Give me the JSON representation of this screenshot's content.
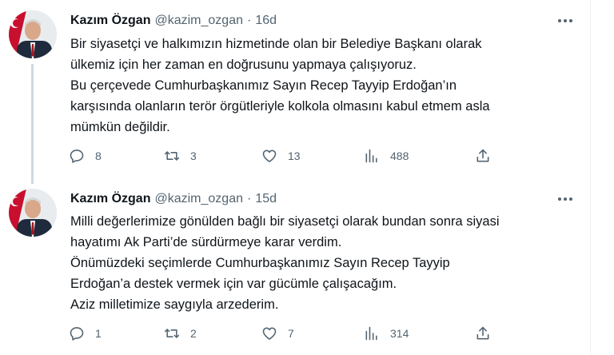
{
  "tweets": [
    {
      "display_name": "Kazım Özgan",
      "handle": "@kazim_ozgan",
      "separator": "·",
      "time": "16d",
      "lines": [
        "Bir siyasetçi ve halkımızın hizmetinde olan bir Belediye Başkanı olarak",
        "ülkemiz için her zaman en doğrusunu yapmaya çalışıyoruz.",
        "Bu çerçevede Cumhurbaşkanımız Sayın Recep Tayyip Erdoğan’ın",
        "karşısında olanların terör örgütleriyle kolkola olmasını kabul etmem asla",
        "mümkün değildir."
      ],
      "replies": "8",
      "retweets": "3",
      "likes": "13",
      "views": "488"
    },
    {
      "display_name": "Kazım Özgan",
      "handle": "@kazim_ozgan",
      "separator": "·",
      "time": "15d",
      "lines": [
        "Milli değerlerimize gönülden bağlı bir siyasetçi olarak bundan sonra siyasi",
        "hayatımı Ak Parti’de sürdürmeye karar verdim.",
        "Önümüzdeki seçimlerde Cumhurbaşkanımız Sayın Recep Tayyip",
        "Erdoğan’a destek vermek için var gücümle çalışacağım.",
        "Aziz milletimize saygıyla arzederim."
      ],
      "replies": "1",
      "retweets": "2",
      "likes": "7",
      "views": "314"
    }
  ],
  "icons": {
    "more": "more-horizontal-icon",
    "reply": "reply-icon",
    "retweet": "retweet-icon",
    "like": "heart-icon",
    "views": "views-chart-icon",
    "share": "share-icon"
  },
  "colors": {
    "text": "#0f1419",
    "secondary": "#536471",
    "thread_line": "#cfd9de"
  }
}
